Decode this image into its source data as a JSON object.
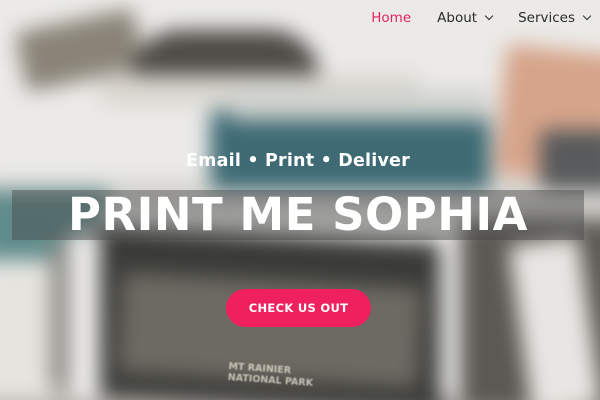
{
  "nav": {
    "items": [
      {
        "label": "Home",
        "active": true,
        "has_dropdown": false
      },
      {
        "label": "About",
        "active": false,
        "has_dropdown": true
      },
      {
        "label": "Services",
        "active": false,
        "has_dropdown": true
      }
    ],
    "active_color": "#e3245f",
    "text_color": "#2b2b2b"
  },
  "hero": {
    "tagline": "Email • Print • Deliver",
    "title": "PRINT ME SOPHIA",
    "cta_label": "CHECK US OUT",
    "cta_color": "#f0205d",
    "card_text": "MT RAINIER\nNATIONAL PARK"
  }
}
